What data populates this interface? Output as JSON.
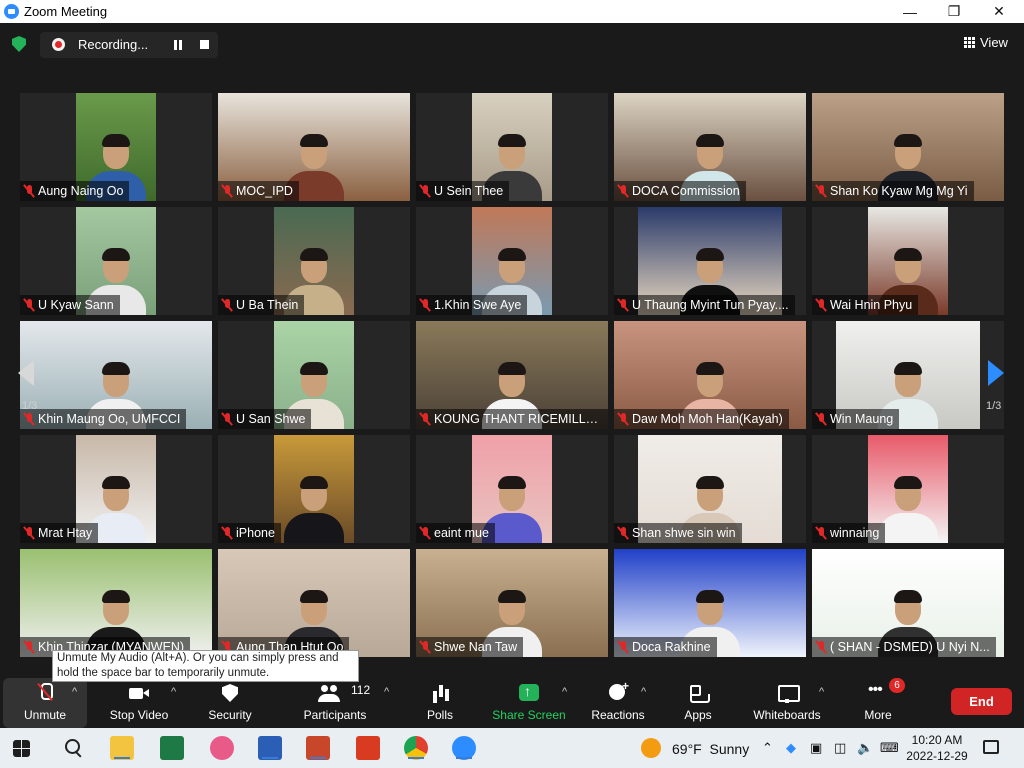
{
  "window": {
    "title": "Zoom Meeting",
    "minimize": "—",
    "maximize": "❐",
    "close": "✕"
  },
  "topbar": {
    "recording_label": "Recording...",
    "view_label": "View"
  },
  "gallery": {
    "page_left": "1/3",
    "page_right": "1/3",
    "tiles": [
      {
        "name": "Aung Naing Oo",
        "bg1": "#6a9a4a",
        "bg2": "#3f6a2c",
        "shirt": "#2f5fa8"
      },
      {
        "name": "MOC_IPD",
        "bg1": "#e8e4dc",
        "bg2": "#8a6040",
        "shirt": "#7a3b2a"
      },
      {
        "name": "U Sein Thee",
        "bg1": "#d8d0c0",
        "bg2": "#a89c88",
        "shirt": "#3a3a3a"
      },
      {
        "name": "DOCA Commission",
        "bg1": "#dcd4c4",
        "bg2": "#6a5040",
        "shirt": "#d0e6e8"
      },
      {
        "name": "Shan Ko Kyaw Mg Mg Yi",
        "bg1": "#bca088",
        "bg2": "#7a5c44",
        "shirt": "#20242a"
      },
      {
        "name": "U Kyaw Sann",
        "bg1": "#a4c8a0",
        "bg2": "#7aa07a",
        "shirt": "#e8e8e8"
      },
      {
        "name": "U Ba Thein",
        "bg1": "#4a6a52",
        "bg2": "#8a6a50",
        "shirt": "#c6b08a"
      },
      {
        "name": "1.Khin Swe Aye",
        "bg1": "#c07858",
        "bg2": "#7a9ab0",
        "shirt": "#c8d4dc"
      },
      {
        "name": "U Thaung Myint Tun  Pyay....",
        "bg1": "#2a3a6a",
        "bg2": "#e8d8c0",
        "shirt": "#101010"
      },
      {
        "name": "Wai Hnin Phyu",
        "bg1": "#e8e8e4",
        "bg2": "#7a3a2a",
        "shirt": "#5a2a1a"
      },
      {
        "name": "Khin Maung Oo, UMFCCI",
        "bg1": "#e4e8ec",
        "bg2": "#9ab0b4",
        "shirt": "#f0f0f0"
      },
      {
        "name": "U San Shwe",
        "bg1": "#aad4a6",
        "bg2": "#8ab08a",
        "shirt": "#e8e2d6"
      },
      {
        "name": "KOUNG THANT RICEMILLU...",
        "bg1": "#8a7a5a",
        "bg2": "#4a4036",
        "shirt": "#f4f4f4"
      },
      {
        "name": "Daw Moh Moh Han(Kayah)",
        "bg1": "#c89480",
        "bg2": "#8a5a44",
        "shirt": "#e8b4a4"
      },
      {
        "name": "Win Maung",
        "bg1": "#f0f0ee",
        "bg2": "#c8c8c4",
        "shirt": "#e4ecec"
      },
      {
        "name": "Mrat Htay",
        "bg1": "#c8b8a8",
        "bg2": "#f0f0f0",
        "shirt": "#e8ecf4"
      },
      {
        "name": "iPhone",
        "bg1": "#c89a3a",
        "bg2": "#6a4a28",
        "shirt": "#15151a"
      },
      {
        "name": "eaint mue",
        "bg1": "#f0a0a8",
        "bg2": "#e8c4c0",
        "shirt": "#5a5acc"
      },
      {
        "name": "Shan shwe sin win",
        "bg1": "#f0ece8",
        "bg2": "#e4dcd4",
        "shirt": "#d8c8b8"
      },
      {
        "name": "winnaing",
        "bg1": "#e85a6a",
        "bg2": "#f4f4f4",
        "shirt": "#f4f4f4"
      },
      {
        "name": "Khin Thinzar (MYANWEN)",
        "bg1": "#9ac070",
        "bg2": "#f0f0f0",
        "shirt": "#1a1a1a"
      },
      {
        "name": "Aung Than Htut Oo",
        "bg1": "#d8c8b8",
        "bg2": "#b8a898",
        "shirt": "#2a2a2e"
      },
      {
        "name": "Shwe Nan Taw",
        "bg1": "#c8b090",
        "bg2": "#8a7050",
        "shirt": "#f0f0f0"
      },
      {
        "name": "Doca Rakhine",
        "bg1": "#2040c8",
        "bg2": "#f0f4fc",
        "shirt": "#f0f0f0"
      },
      {
        "name": "( SHAN - DSMED) U Nyi N...",
        "bg1": "#ffffff",
        "bg2": "#e8f0e8",
        "shirt": "#303030"
      }
    ]
  },
  "tooltip": {
    "text": "Unmute My Audio (Alt+A). Or you can simply press and hold the space bar to temporarily unmute."
  },
  "toolbar": {
    "unmute": "Unmute",
    "stop_video": "Stop Video",
    "security": "Security",
    "participants": "Participants",
    "participants_count": "112",
    "polls": "Polls",
    "share_screen": "Share Screen",
    "reactions": "Reactions",
    "apps": "Apps",
    "whiteboards": "Whiteboards",
    "more": "More",
    "more_badge": "6",
    "end": "End",
    "caret": "^"
  },
  "taskbar": {
    "weather_temp": "69°F",
    "weather_cond": "Sunny",
    "time": "10:20 AM",
    "date": "2022-12-29",
    "apps": [
      "start-icon",
      "search-icon",
      "file-explorer-icon",
      "excel-icon",
      "snipping-icon",
      "word-icon",
      "powerpoint-icon",
      "office-icon",
      "chrome-icon",
      "zoom-icon"
    ]
  }
}
